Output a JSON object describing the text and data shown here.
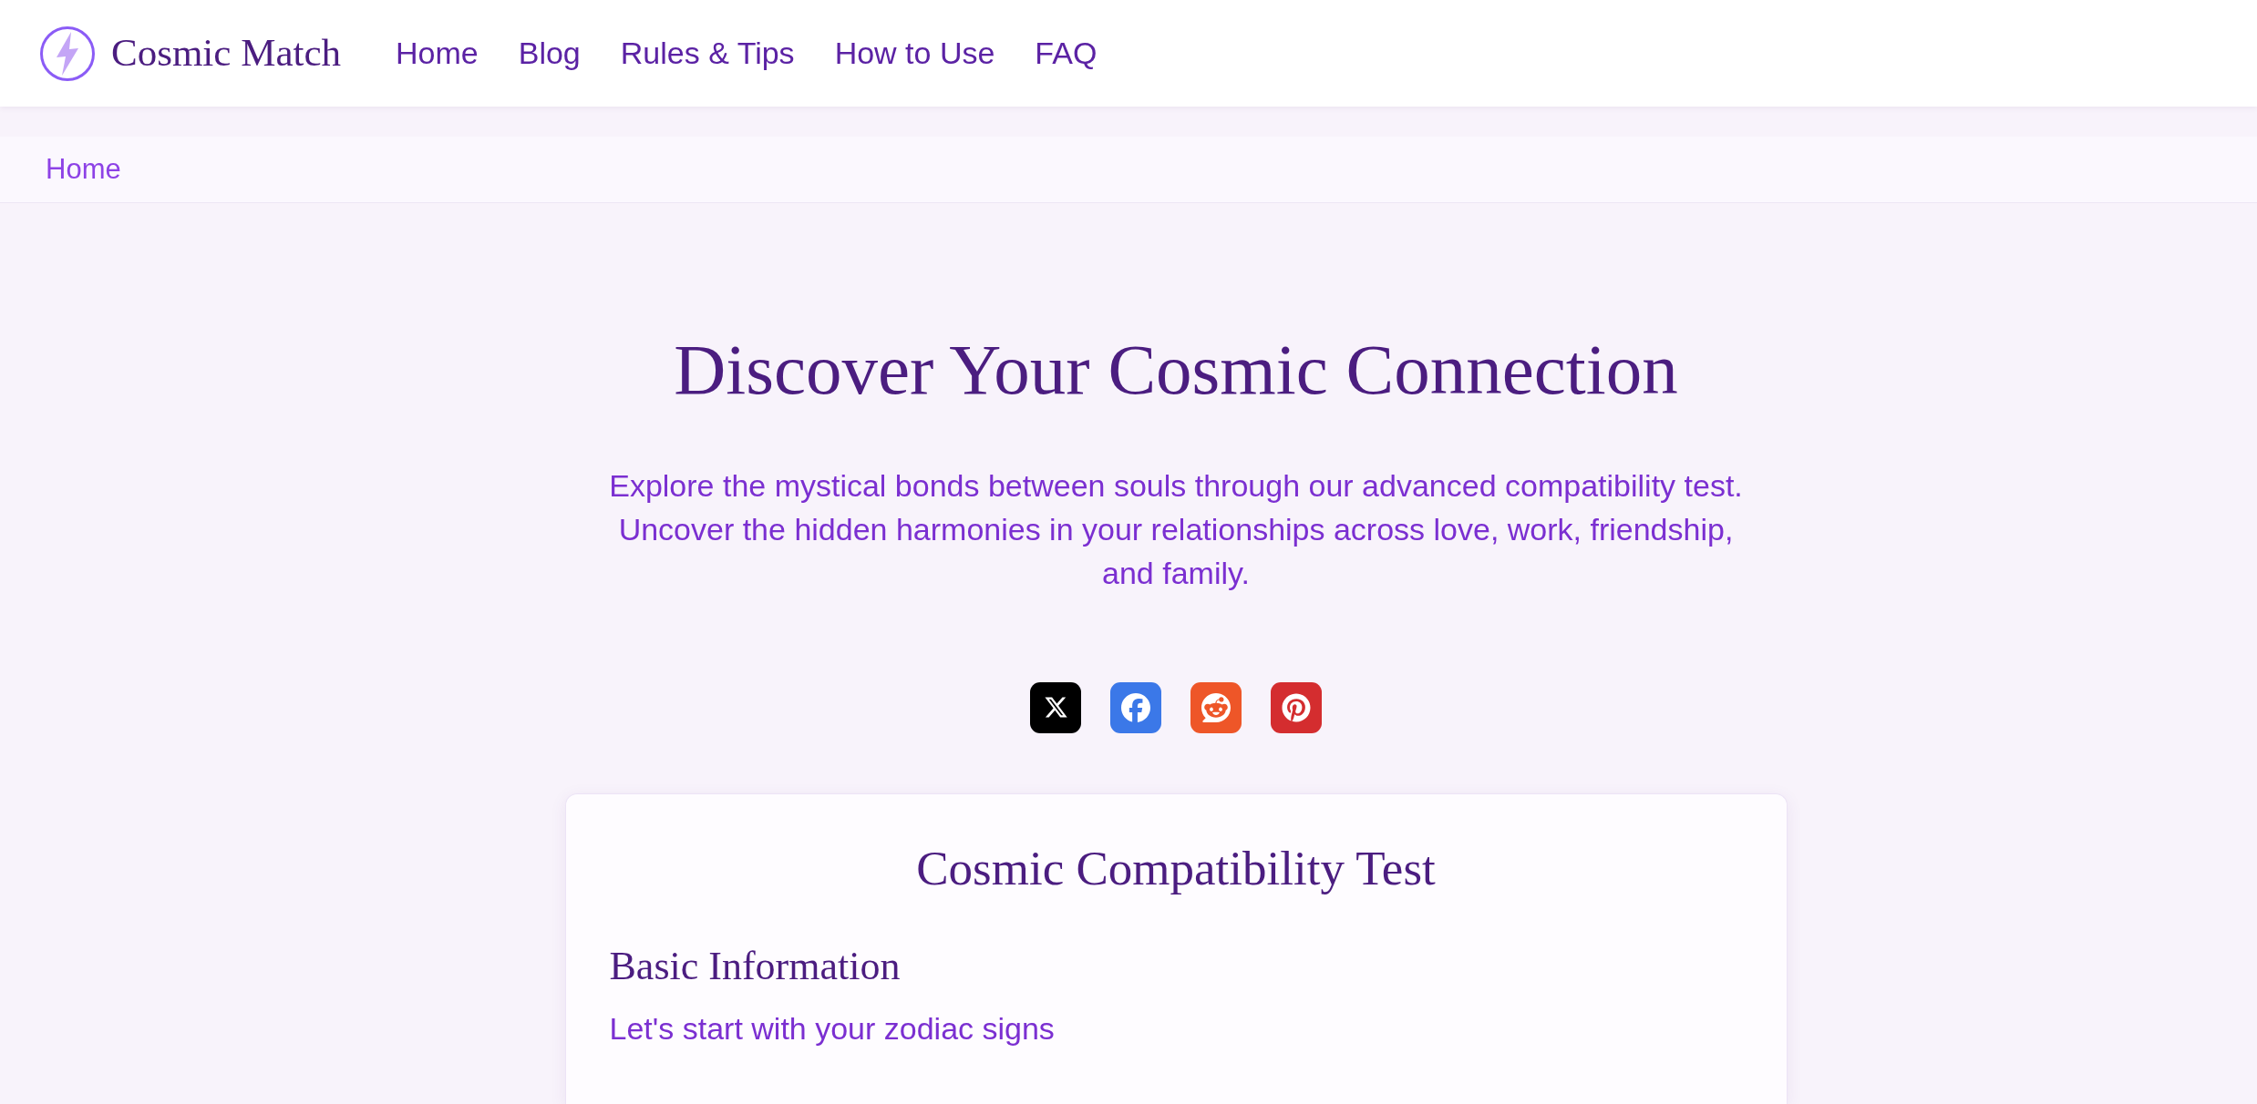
{
  "header": {
    "brand": "Cosmic Match",
    "nav": [
      "Home",
      "Blog",
      "Rules & Tips",
      "How to Use",
      "FAQ"
    ]
  },
  "breadcrumb": [
    "Home"
  ],
  "hero": {
    "title": "Discover Your Cosmic Connection",
    "subtitle": "Explore the mystical bonds between souls through our advanced compatibility test. Uncover the hidden harmonies in your relationships across love, work, friendship, and family."
  },
  "share_buttons": [
    {
      "kind": "x"
    },
    {
      "kind": "facebook"
    },
    {
      "kind": "reddit"
    },
    {
      "kind": "pinterest"
    }
  ],
  "card": {
    "title": "Cosmic Compatibility Test",
    "section": {
      "title": "Basic Information",
      "subtitle": "Let's start with your zodiac signs"
    }
  }
}
